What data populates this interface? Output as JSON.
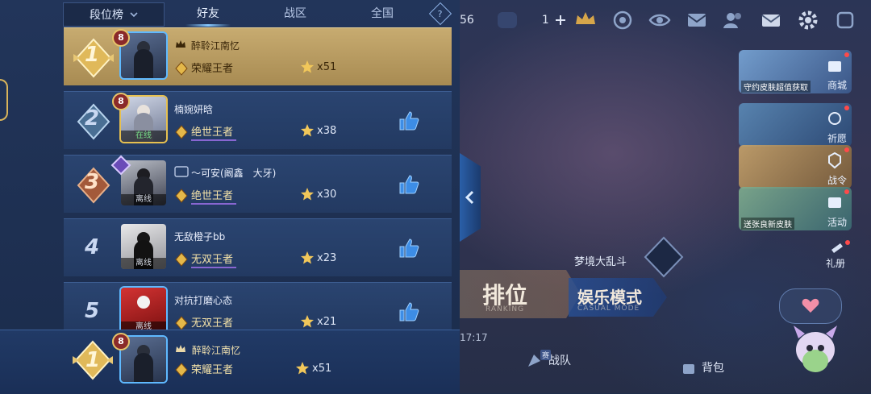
{
  "leaderboard": {
    "dropdown_label": "段位榜",
    "tabs": [
      "好友",
      "战区",
      "全国"
    ],
    "active_tab": "好友",
    "help_glyph": "?",
    "rows": [
      {
        "rank": "1",
        "level": "8",
        "status": "",
        "name": "醉聆江南忆",
        "tier": "荣耀王者",
        "stars": "x51",
        "is_me": true
      },
      {
        "rank": "2",
        "level": "8",
        "status": "在线",
        "name": "楠婉妍晗",
        "tier": "绝世王者",
        "stars": "x38"
      },
      {
        "rank": "3",
        "level": "",
        "status": "离线",
        "name": "～可安(阚鑫　大牙)",
        "tier": "绝世王者",
        "stars": "x30"
      },
      {
        "rank": "4",
        "level": "",
        "status": "离线",
        "name": "无敌橙子bb",
        "tier": "无双王者",
        "stars": "x23"
      },
      {
        "rank": "5",
        "level": "",
        "status": "离线",
        "name": "对抗打磨心态",
        "tier": "无双王者",
        "stars": "x21"
      }
    ],
    "me": {
      "rank": "1",
      "level": "8",
      "name": "醉聆江南忆",
      "tier": "荣耀王者",
      "stars": "x51"
    }
  },
  "topbar": {
    "partial_number": "56",
    "plus_count": "1"
  },
  "side_menu": [
    {
      "label": "商城",
      "caption": "守约皮肤超值获取"
    },
    {
      "label": "祈愿",
      "caption": ""
    },
    {
      "label": "战令",
      "caption": ""
    },
    {
      "label": "活动",
      "caption": "送张良新皮肤"
    },
    {
      "label": "礼册",
      "caption": ""
    }
  ],
  "modes": {
    "ranking_cn": "排位",
    "ranking_en": "RANKING",
    "casual_cn": "娱乐模式",
    "casual_en": "CASUAL MODE",
    "event_label": "梦境大乱斗"
  },
  "bottom_nav": {
    "team": "战队",
    "team_badge": "赛",
    "bag": "背包",
    "time": "17:17"
  },
  "colors": {
    "gold": "#d9b45a",
    "panel": "#22355a",
    "highlight": "#c7ab70",
    "accent_blue": "#5fb9ff"
  }
}
